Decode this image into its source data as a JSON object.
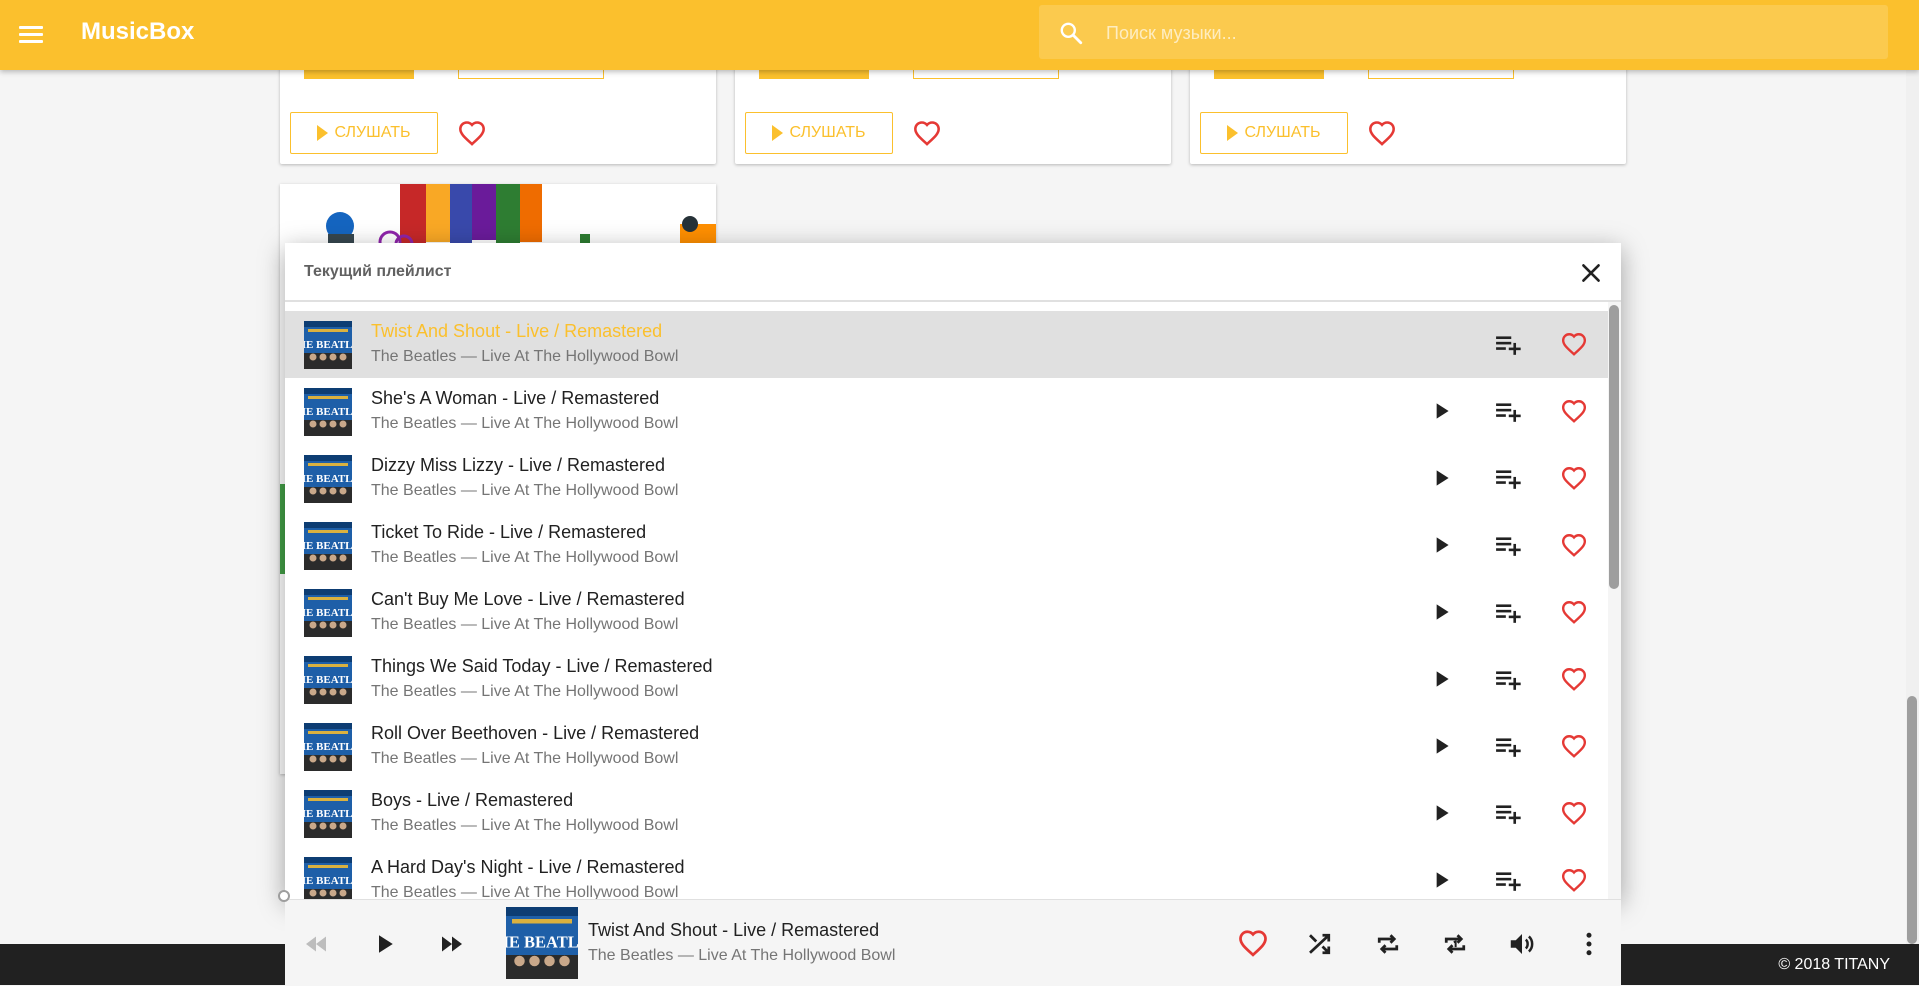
{
  "app": {
    "title": "MusicBox"
  },
  "search": {
    "placeholder": "Поиск музыки..."
  },
  "cards": {
    "listen_label": "СЛУШАТЬ"
  },
  "panel": {
    "title": "Текущий плейлист",
    "album_art_text": "THE BEATLES",
    "tracks": [
      {
        "title": "Twist And Shout - Live / Remastered",
        "subtitle": "The Beatles — Live At The Hollywood Bowl",
        "active": true
      },
      {
        "title": "She's A Woman - Live / Remastered",
        "subtitle": "The Beatles — Live At The Hollywood Bowl",
        "active": false
      },
      {
        "title": "Dizzy Miss Lizzy - Live / Remastered",
        "subtitle": "The Beatles — Live At The Hollywood Bowl",
        "active": false
      },
      {
        "title": "Ticket To Ride - Live / Remastered",
        "subtitle": "The Beatles — Live At The Hollywood Bowl",
        "active": false
      },
      {
        "title": "Can't Buy Me Love - Live / Remastered",
        "subtitle": "The Beatles — Live At The Hollywood Bowl",
        "active": false
      },
      {
        "title": "Things We Said Today - Live / Remastered",
        "subtitle": "The Beatles — Live At The Hollywood Bowl",
        "active": false
      },
      {
        "title": "Roll Over Beethoven - Live / Remastered",
        "subtitle": "The Beatles — Live At The Hollywood Bowl",
        "active": false
      },
      {
        "title": "Boys - Live / Remastered",
        "subtitle": "The Beatles — Live At The Hollywood Bowl",
        "active": false
      },
      {
        "title": "A Hard Day's Night - Live / Remastered",
        "subtitle": "The Beatles — Live At The Hollywood Bowl",
        "active": false
      }
    ]
  },
  "player": {
    "title": "Twist And Shout - Live / Remastered",
    "subtitle": "The Beatles — Live At The Hollywood Bowl"
  },
  "footer": {
    "copyright": "© 2018 TITANY"
  },
  "colors": {
    "accent": "#fbc02d",
    "heart": "#e53935",
    "album_blue": "#1e5fa8",
    "footer": "#212121"
  },
  "icons": {
    "menu": "menu-icon",
    "search": "search-icon",
    "close": "close-icon",
    "play": "play-icon",
    "playlist_add": "playlist-add-icon",
    "heart": "heart-outline-icon",
    "prev": "skip-previous-icon",
    "next": "skip-next-icon",
    "shuffle": "shuffle-icon",
    "repeat": "repeat-icon",
    "repeat_one": "repeat-one-icon",
    "volume": "volume-icon",
    "more": "more-vert-icon"
  }
}
